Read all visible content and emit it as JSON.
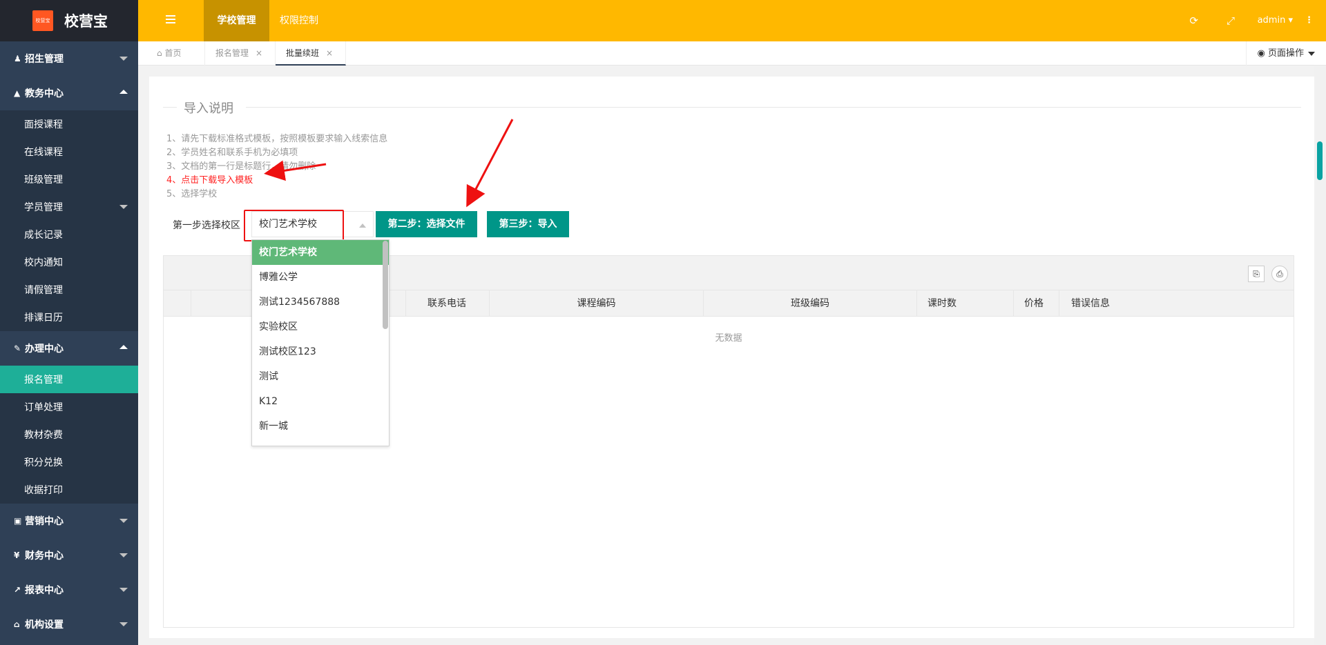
{
  "app": {
    "logo_text": "校营宝",
    "logo_mark": "校营宝",
    "user": "admin"
  },
  "header": {
    "tabs": [
      "学校管理",
      "权限控制"
    ]
  },
  "sidebar": {
    "groups": [
      {
        "label": "招生管理",
        "icon": "person-icon"
      },
      {
        "label": "教务中心",
        "icon": "graduation-cap-icon",
        "items": [
          "面授课程",
          "在线课程",
          "班级管理",
          "学员管理",
          "成长记录",
          "校内通知",
          "请假管理",
          "排课日历"
        ]
      },
      {
        "label": "办理中心",
        "icon": "edit-icon",
        "items": [
          "报名管理",
          "订单处理",
          "教材杂费",
          "积分兑换",
          "收据打印"
        ]
      },
      {
        "label": "营销中心",
        "icon": "laptop-icon"
      },
      {
        "label": "财务中心",
        "icon": "yen-icon"
      },
      {
        "label": "报表中心",
        "icon": "line-chart-icon"
      },
      {
        "label": "机构设置",
        "icon": "bank-icon"
      }
    ],
    "active_item": "报名管理"
  },
  "tabbar": {
    "tabs": [
      "首页",
      "报名管理",
      "批量续班"
    ],
    "page_ops": "页面操作"
  },
  "import": {
    "title": "导入说明",
    "instructions": [
      "1、请先下载标准格式模板，按照模板要求输入线索信息",
      "2、学员姓名和联系手机为必填项",
      "3、文档的第一行是标题行，请勿删除",
      "4、点击下载导入模板",
      "5、选择学校"
    ],
    "step1_label": "第一步选择校区",
    "selected_campus": "校门艺术学校",
    "step2_button": "第二步：选择文件",
    "step3_button": "第三步：导入"
  },
  "table": {
    "columns": [
      "联系电话",
      "课程编码",
      "班级编码",
      "课时数",
      "价格",
      "错误信息"
    ],
    "empty_text": "无数据"
  },
  "dropdown": {
    "options": [
      "校门艺术学校",
      "博雅公学",
      "测试1234567888",
      "实验校区",
      "测试校区123",
      "测试",
      "K12",
      "新一城"
    ],
    "selected_index": 0
  },
  "colors": {
    "header": "#ffb800",
    "sidebar": "#2f4056",
    "active": "#1eaf98",
    "button": "#009688",
    "selected": "#5fb878"
  }
}
